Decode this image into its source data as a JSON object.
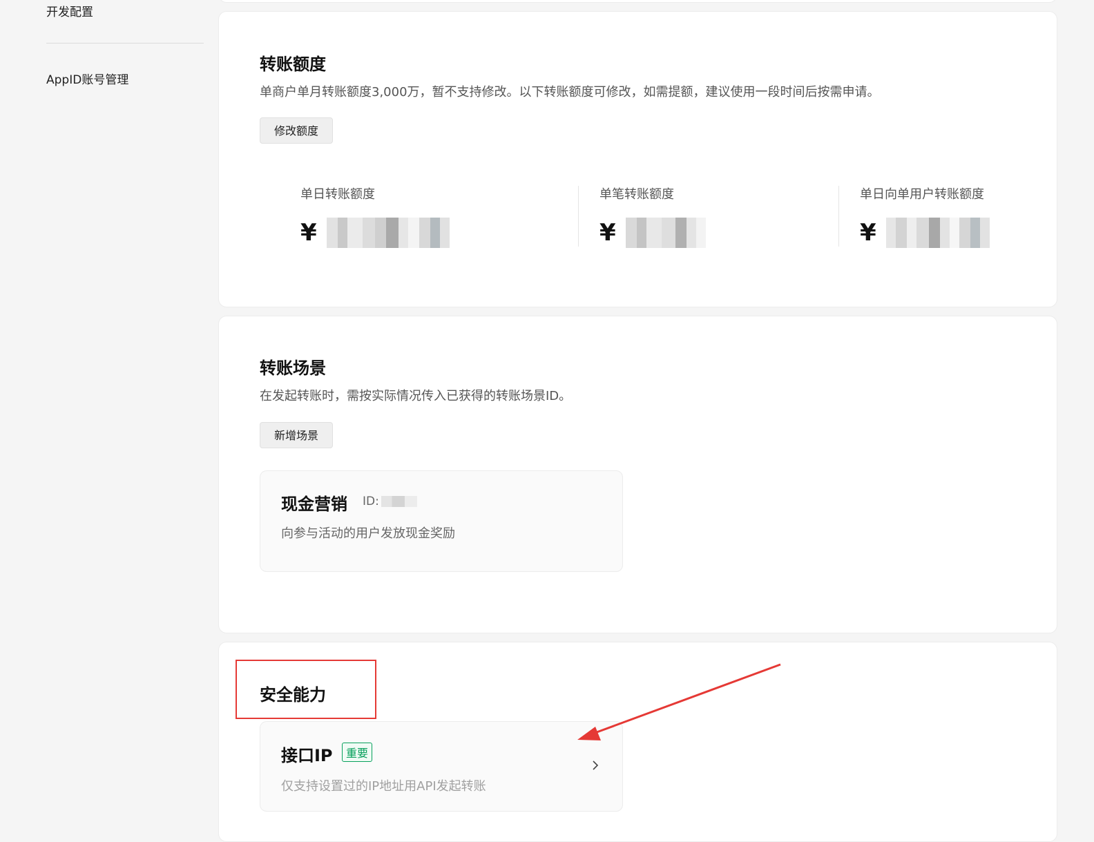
{
  "sidebar": {
    "items": [
      {
        "label": "开发配置"
      },
      {
        "label": "AppID账号管理"
      }
    ]
  },
  "quota": {
    "title": "转账额度",
    "desc": "单商户单月转账额度3,000万，暂不支持修改。以下转账额度可修改，如需提额，建议使用一段时间后按需申请。",
    "button": "修改额度",
    "currency": "¥",
    "columns": [
      {
        "label": "单日转账额度"
      },
      {
        "label": "单笔转账额度"
      },
      {
        "label": "单日向单用户转账额度"
      }
    ]
  },
  "scene": {
    "title": "转账场景",
    "desc": "在发起转账时，需按实际情况传入已获得的转账场景ID。",
    "button": "新增场景",
    "item": {
      "name": "现金营销",
      "id_label": "ID:",
      "desc": "向参与活动的用户发放现金奖励"
    }
  },
  "security": {
    "title": "安全能力",
    "item": {
      "name": "接口IP",
      "badge": "重要",
      "desc": "仅支持设置过的IP地址用API发起转账"
    }
  },
  "colors": {
    "accent_green": "#07a05c",
    "annotation_red": "#e53935"
  }
}
